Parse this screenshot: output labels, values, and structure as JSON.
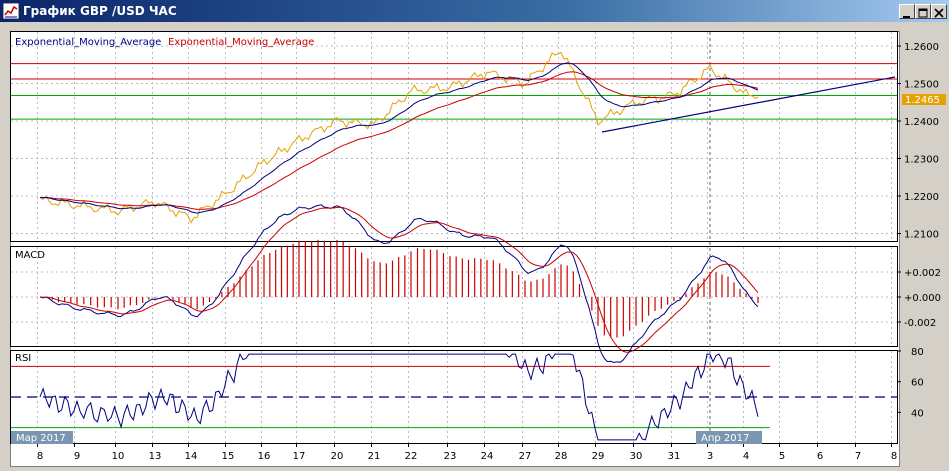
{
  "window": {
    "title": "График GBP /USD  ЧАС"
  },
  "icons": {
    "app": "chart-app-icon",
    "minimize": "minimize-icon",
    "maximize": "maximize-icon",
    "close": "close-icon"
  },
  "colors": {
    "price": "#e5a100",
    "ema_fast": "#000080",
    "ema_slow": "#cc0000",
    "resistance": "#cc0000",
    "support": "#00aa00",
    "trendline": "#00007f",
    "macd_hist": "#cc0000",
    "rsi_line": "#000080",
    "rsi_overbought": "#ff00ff",
    "rsi_oversold": "#00cc00",
    "grid": "#b7bcc4",
    "price_tag_bg": "#e5a100"
  },
  "price_panel": {
    "indicator_label_1": "Exponential_Moving_Average",
    "indicator_label_2": "Exponential_Moving_Average",
    "current_price": "1.2465",
    "horizontal_levels": {
      "resistance": [
        1.2553,
        1.2512
      ],
      "support": [
        1.2468,
        1.2405
      ]
    }
  },
  "macd_panel": {
    "label": "MACD"
  },
  "rsi_panel": {
    "label": "RSI",
    "levels": [
      70,
      50,
      30
    ]
  },
  "x_axis": {
    "labels": [
      "8",
      "9",
      "10",
      "13",
      "14",
      "15",
      "16",
      "17",
      "20",
      "21",
      "22",
      "23",
      "24",
      "27",
      "28",
      "29",
      "30",
      "31",
      "3",
      "4",
      "5",
      "6",
      "7",
      "8"
    ],
    "period_tags": [
      "Мар 2017",
      "Апр 2017"
    ]
  },
  "chart_data": [
    {
      "type": "line",
      "title": "",
      "series": [
        {
          "name": "Exponential_Moving_Average"
        },
        {
          "name": "Exponential_Moving_Average"
        }
      ],
      "x_categories": [
        "8",
        "9",
        "10",
        "13",
        "14",
        "15",
        "16",
        "17",
        "20",
        "21",
        "22",
        "23",
        "24",
        "27",
        "28",
        "29",
        "30",
        "31",
        "3",
        "4"
      ],
      "price_close": [
        1.219,
        1.2175,
        1.216,
        1.2185,
        1.214,
        1.221,
        1.229,
        1.235,
        1.24,
        1.239,
        1.248,
        1.249,
        1.253,
        1.25,
        1.259,
        1.24,
        1.245,
        1.247,
        1.254,
        1.247
      ],
      "ylim": [
        1.208,
        1.264
      ],
      "y_ticks": [
        "1.2600",
        "1.2500",
        "1.2400",
        "1.2300",
        "1.2200",
        "1.2100"
      ]
    },
    {
      "type": "line",
      "title": "",
      "series": [
        {
          "name": "MACD"
        }
      ],
      "y_ticks": [
        "+0.002",
        "+0.000",
        "-0.002"
      ]
    },
    {
      "type": "line",
      "title": "",
      "series": [
        {
          "name": "RSI"
        }
      ],
      "ylim": [
        20,
        80
      ],
      "y_ticks": [
        "80",
        "60",
        "40"
      ]
    }
  ]
}
